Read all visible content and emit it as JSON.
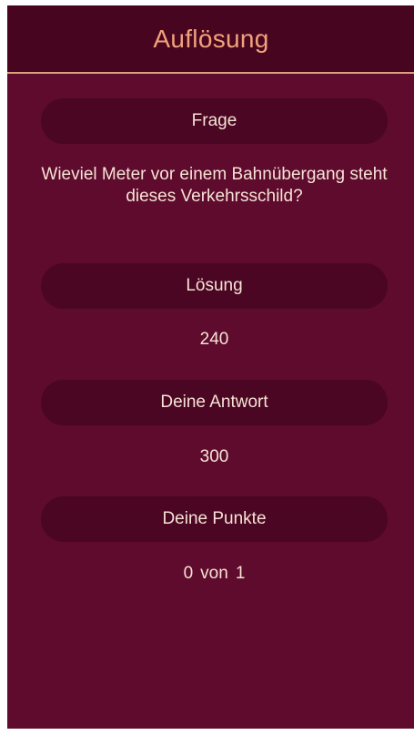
{
  "app_bar": {
    "title": "Auflösung"
  },
  "sections": {
    "question": {
      "label": "Frage",
      "text": "Wieviel Meter vor einem Bahnübergang steht dieses Verkehrsschild?"
    },
    "solution": {
      "label": "Lösung",
      "value": "240"
    },
    "your_answer": {
      "label": "Deine Antwort",
      "value": "300"
    },
    "your_points": {
      "label": "Deine Punkte",
      "score": "0",
      "of_label": "von",
      "total": "1"
    }
  },
  "colors": {
    "background": "#5e0b2d",
    "app_bar": "#470520",
    "pill": "#4a0622",
    "title": "#f1a27b",
    "text": "#f7e2d6",
    "divider": "#d9a07c"
  }
}
